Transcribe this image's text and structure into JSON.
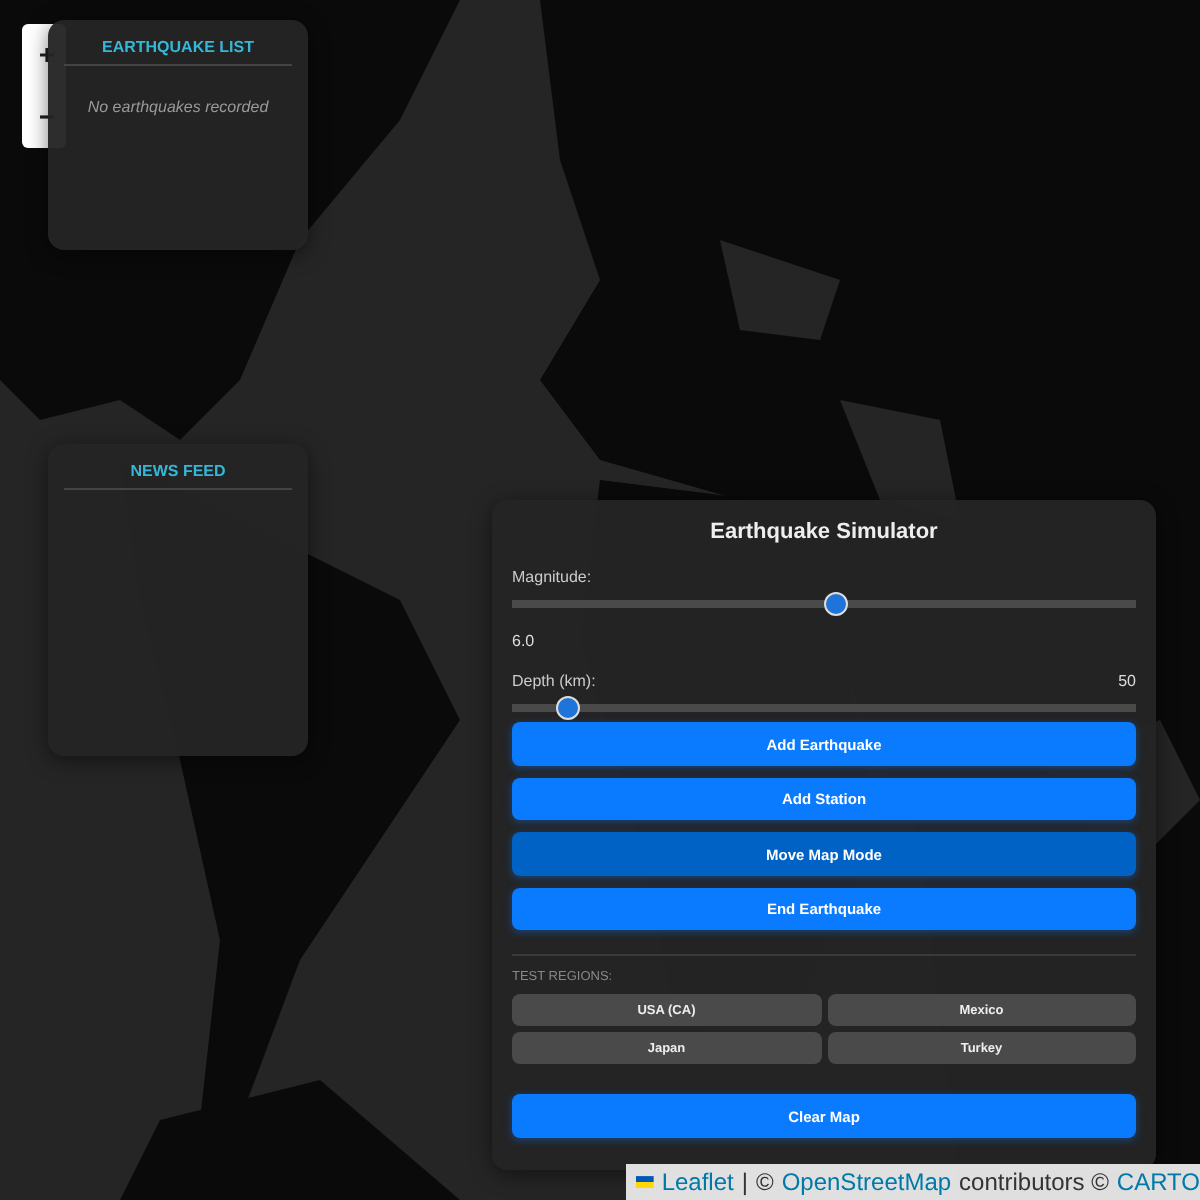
{
  "earthquake_list": {
    "title": "EARTHQUAKE LIST",
    "empty_message": "No earthquakes recorded"
  },
  "news_feed": {
    "title": "NEWS FEED"
  },
  "simulator": {
    "title": "Earthquake Simulator",
    "sliders": [
      {
        "label": "Magnitude:",
        "reading": "6.0",
        "kind": "below",
        "level": 0.52
      },
      {
        "label": "Depth (km):",
        "reading": "50",
        "kind": "inline",
        "level": 0.09
      }
    ],
    "actions": [
      {
        "label": "Add Earthquake",
        "selected": false
      },
      {
        "label": "Add Station",
        "selected": false
      },
      {
        "label": "Move Map Mode",
        "selected": true
      },
      {
        "label": "End Earthquake",
        "selected": false
      }
    ],
    "regions_title": "TEST REGIONS:",
    "regions": [
      "USA (CA)",
      "Mexico",
      "Japan",
      "Turkey"
    ],
    "clear_button": "Clear Map"
  },
  "attribution": [
    {
      "text": "Leaflet",
      "kind": "link"
    },
    {
      "text": "|",
      "kind": "text"
    },
    {
      "text": "©",
      "kind": "text"
    },
    {
      "text": "OpenStreetMap",
      "kind": "link"
    },
    {
      "text": "contributors ©",
      "kind": "text"
    },
    {
      "text": "CARTO",
      "kind": "link"
    }
  ]
}
